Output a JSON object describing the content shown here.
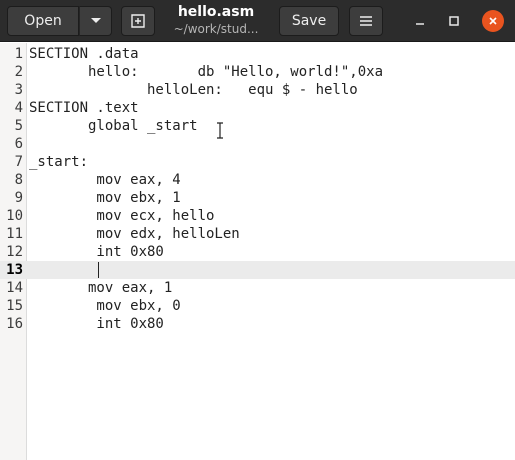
{
  "header": {
    "open_label": "Open",
    "save_label": "Save",
    "title": "hello.asm",
    "subtitle": "~/work/stud...",
    "icons": {
      "dropdown": "chevron-down-icon",
      "new_tab": "new-tab-icon",
      "menu": "hamburger-menu-icon",
      "minimize": "minimize-icon",
      "maximize": "maximize-icon",
      "close": "close-icon"
    },
    "close_color": "#e9541f"
  },
  "editor": {
    "current_line": 13,
    "lines": [
      {
        "num": "1",
        "code": "SECTION .data"
      },
      {
        "num": "2",
        "code": "       hello:       db \"Hello, world!\",0xa"
      },
      {
        "num": "3",
        "code": "              helloLen:   equ $ - hello"
      },
      {
        "num": "4",
        "code": "SECTION .text"
      },
      {
        "num": "5",
        "code": "       global _start"
      },
      {
        "num": "6",
        "code": ""
      },
      {
        "num": "7",
        "code": "_start:"
      },
      {
        "num": "8",
        "code": "        mov eax, 4"
      },
      {
        "num": "9",
        "code": "        mov ebx, 1"
      },
      {
        "num": "10",
        "code": "        mov ecx, hello"
      },
      {
        "num": "11",
        "code": "        mov edx, helloLen"
      },
      {
        "num": "12",
        "code": "        int 0x80"
      },
      {
        "num": "13",
        "code": ""
      },
      {
        "num": "14",
        "code": "       mov eax, 1"
      },
      {
        "num": "15",
        "code": "        mov ebx, 0"
      },
      {
        "num": "16",
        "code": "        int 0x80"
      }
    ]
  }
}
